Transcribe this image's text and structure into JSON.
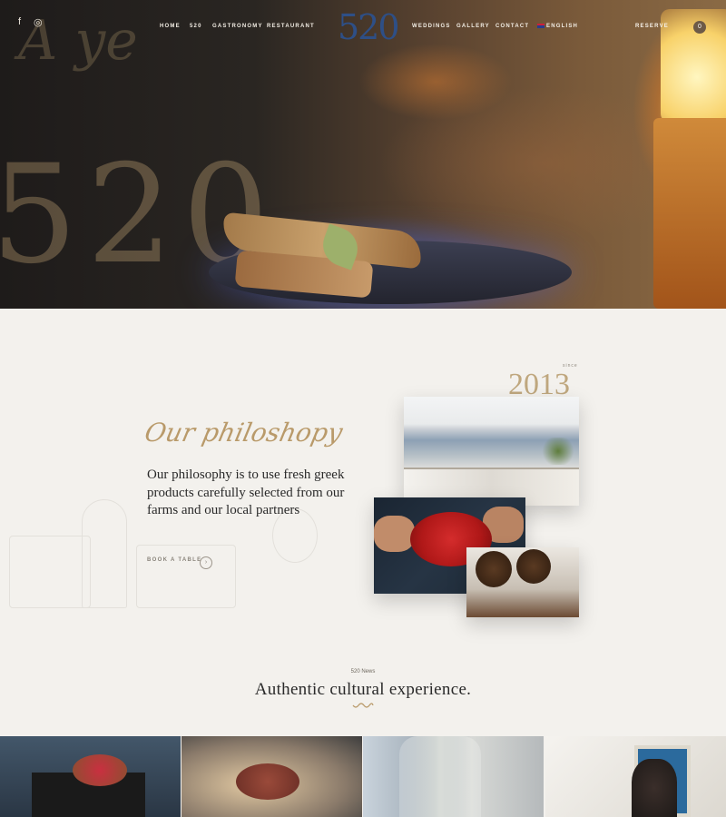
{
  "nav": {
    "social": {
      "facebook": "f",
      "instagram": "◎"
    },
    "left_links": [
      "HOME",
      "520",
      "GASTRONOMY",
      "RESTAURANT"
    ],
    "logo": "520",
    "right_links": [
      "WEDDINGS",
      "GALLERY",
      "CONTACT"
    ],
    "language": "ENGLISH",
    "reserve": "RESERVE",
    "cart_count": "0"
  },
  "philosophy": {
    "since_label": "since",
    "year": "2013",
    "title": "Our philoshopy",
    "text": "Our philosophy is to use fresh greek products carefully selected from our farms and our local partners",
    "cta": "BOOK A TABLE",
    "cta_icon": "›"
  },
  "news": {
    "label": "520 News",
    "title": "Authentic cultural experience."
  },
  "colors": {
    "accent": "#b99a6a",
    "logo": "#2e4f86",
    "background": "#f3f1ed"
  }
}
